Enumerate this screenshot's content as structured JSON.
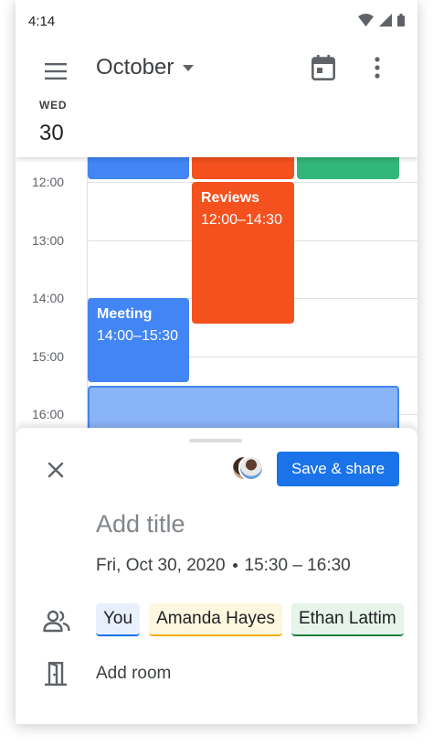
{
  "status_bar": {
    "time": "4:14"
  },
  "app_bar": {
    "month": "October",
    "day_name": "WED",
    "day_number": "30"
  },
  "grid": {
    "hours": [
      "12:00",
      "13:00",
      "14:00",
      "15:00",
      "16:00"
    ],
    "events": [
      {
        "title": "Reviews",
        "time": "12:00–14:30",
        "color": "#f4511e"
      },
      {
        "title": "Meeting",
        "time": "14:00–15:30",
        "color": "#4285f4"
      }
    ],
    "colors": {
      "blue": "#4285f4",
      "orange": "#f4511e",
      "green": "#33b679",
      "draft": "#8ab4f8"
    }
  },
  "sheet": {
    "save_label": "Save & share",
    "title_placeholder": "Add title",
    "date": "Fri, Oct 30, 2020",
    "time_range": "15:30 – 16:30",
    "guests": [
      "You",
      "Amanda Hayes",
      "Ethan Lattim"
    ],
    "room_label": "Add room",
    "accent": "#1a73e8"
  },
  "icons": {
    "menu": "menu-icon",
    "dropdown": "chevron-down-icon",
    "today": "calendar-today-icon",
    "more": "more-vert-icon",
    "close": "close-icon",
    "people": "people-icon",
    "room": "door-icon"
  }
}
